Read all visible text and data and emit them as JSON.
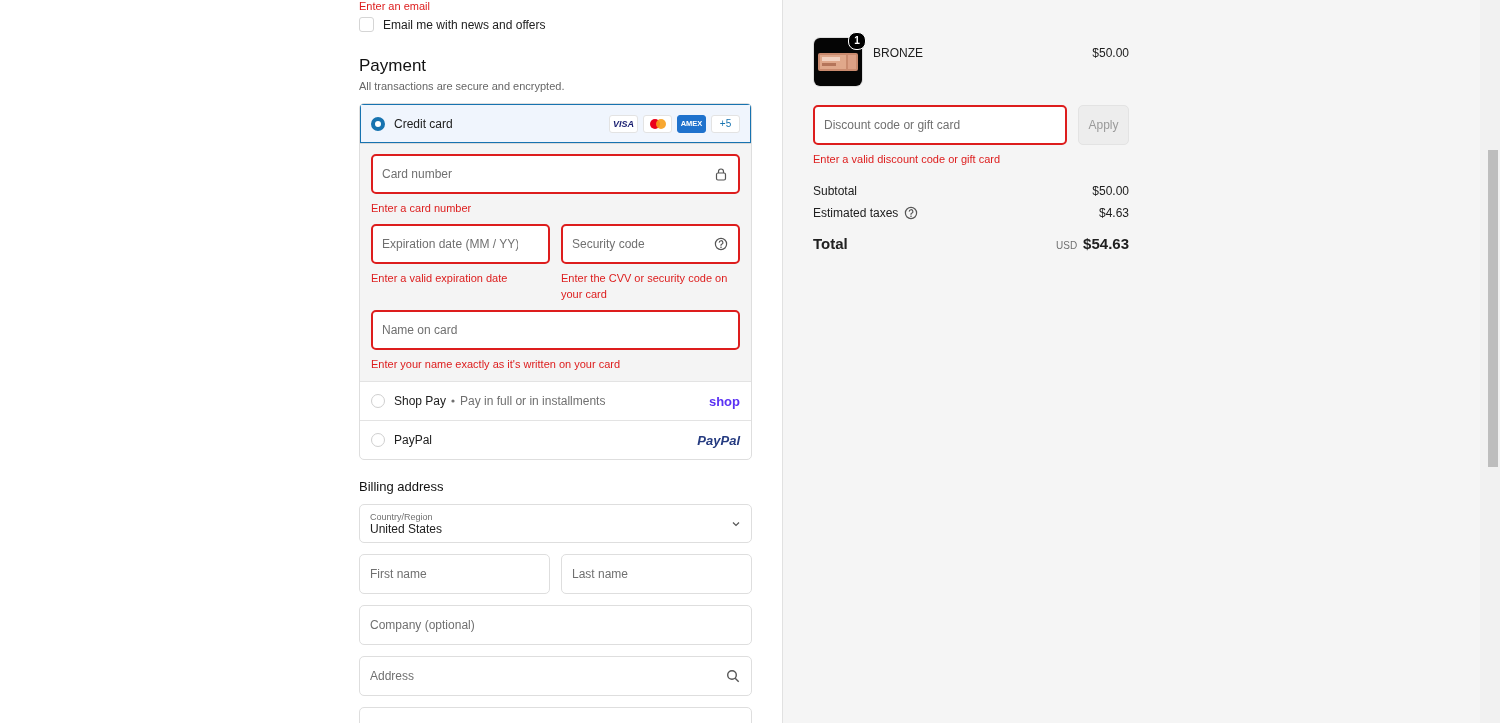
{
  "contact": {
    "error": "Enter an email",
    "newsletter": {
      "label": "Email me with news and offers",
      "checked": false
    }
  },
  "payment": {
    "title": "Payment",
    "subtitle": "All transactions are secure and encrypted.",
    "methods": [
      {
        "kind": "card",
        "label": "Credit card",
        "selected": true,
        "brands": [
          {
            "kind": "visa",
            "label": "VISA"
          },
          {
            "kind": "mastercard"
          },
          {
            "kind": "amex",
            "label": "AMEX"
          },
          {
            "kind": "more",
            "label": "+5"
          }
        ],
        "rows": [
          [
            {
              "kind": "card_number",
              "placeholder": "Card number",
              "invalid": true,
              "error": "Enter a card number"
            }
          ],
          [
            {
              "kind": "expiry",
              "placeholder": "Expiration date (MM / YY)",
              "invalid": true,
              "error": "Enter a valid expiration date"
            },
            {
              "kind": "cvv",
              "placeholder": "Security code",
              "invalid": true,
              "error": "Enter the CVV or security code on your card"
            }
          ],
          [
            {
              "kind": "name",
              "placeholder": "Name on card",
              "invalid": true,
              "error": "Enter your name exactly as it's written on your card"
            }
          ]
        ]
      },
      {
        "kind": "shop",
        "label": "Shop Pay",
        "note": "Pay in full or in installments",
        "logo": "shop",
        "selected": false
      },
      {
        "kind": "paypal",
        "label": "PayPal",
        "logo": "PayPal",
        "selected": false
      }
    ]
  },
  "billing": {
    "title": "Billing address",
    "rows": [
      [
        {
          "kind": "select",
          "label": "Country/Region",
          "value": "United States"
        }
      ],
      [
        {
          "kind": "text",
          "placeholder": "First name"
        },
        {
          "kind": "text",
          "placeholder": "Last name"
        }
      ],
      [
        {
          "kind": "text",
          "placeholder": "Company (optional)"
        }
      ],
      [
        {
          "kind": "address",
          "placeholder": "Address"
        }
      ],
      [
        {
          "kind": "blank"
        }
      ]
    ]
  },
  "summary": {
    "items": [
      {
        "name": "BRONZE",
        "price": "$50.00",
        "quantity": "1"
      }
    ],
    "discount": {
      "placeholder": "Discount code or gift card",
      "invalid": true,
      "error": "Enter a valid discount code or gift card",
      "button": "Apply",
      "disabled": true
    },
    "lines": [
      {
        "kind": "plain",
        "label": "Subtotal",
        "value": "$50.00"
      },
      {
        "kind": "info",
        "label": "Estimated taxes",
        "value": "$4.63"
      }
    ],
    "total": {
      "label": "Total",
      "currency": "USD",
      "amount": "$54.63"
    }
  }
}
